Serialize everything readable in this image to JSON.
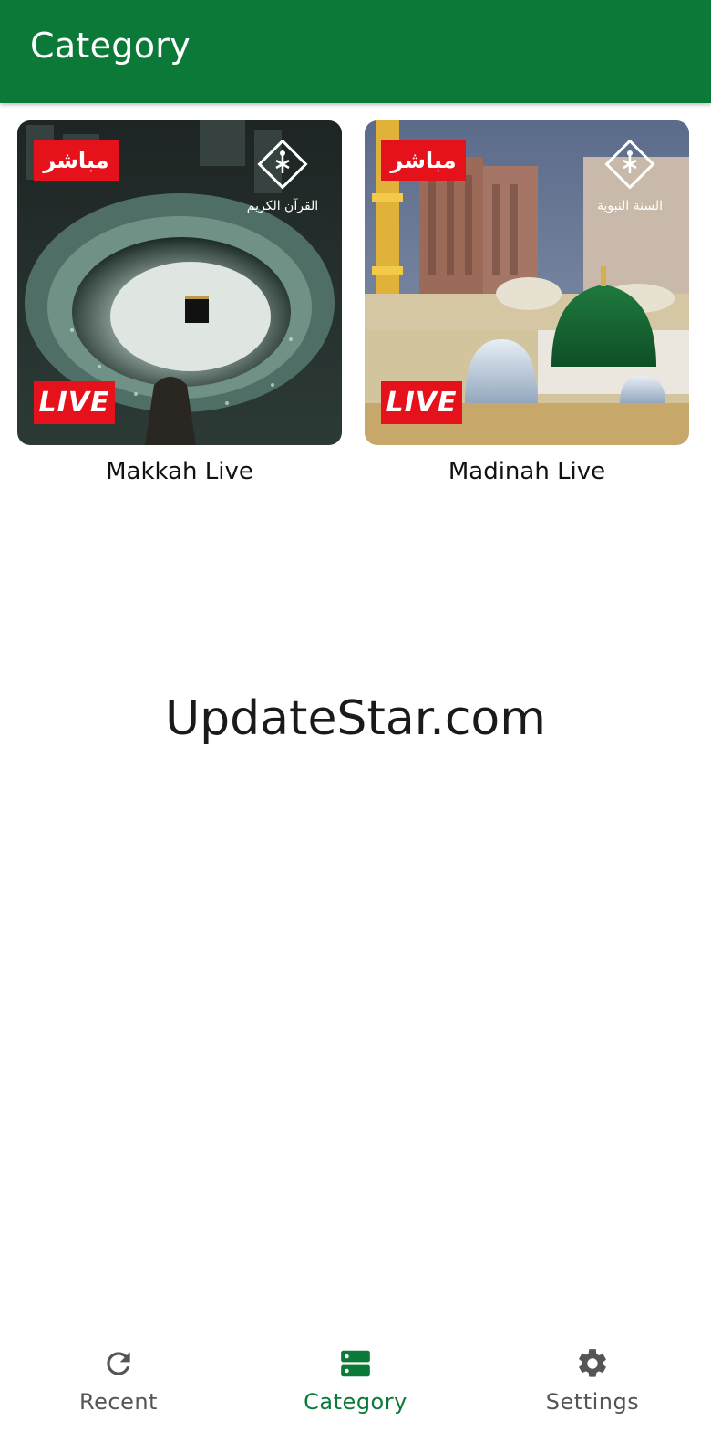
{
  "appbar": {
    "title": "Category"
  },
  "colors": {
    "primary": "#0b7a39",
    "badge": "#e5121c",
    "inactive": "#555555"
  },
  "cards": [
    {
      "label": "Makkah Live",
      "badge_ar": "مباشر",
      "badge_live": "LIVE",
      "channel": "القرآن الكريم"
    },
    {
      "label": "Madinah Live",
      "badge_ar": "مباشر",
      "badge_live": "LIVE",
      "channel": "السنة النبوية"
    }
  ],
  "watermark": "UpdateStar.com",
  "bottom_nav": {
    "items": [
      {
        "label": "Recent",
        "icon": "refresh-icon",
        "active": false
      },
      {
        "label": "Category",
        "icon": "category-icon",
        "active": true
      },
      {
        "label": "Settings",
        "icon": "gear-icon",
        "active": false
      }
    ]
  }
}
